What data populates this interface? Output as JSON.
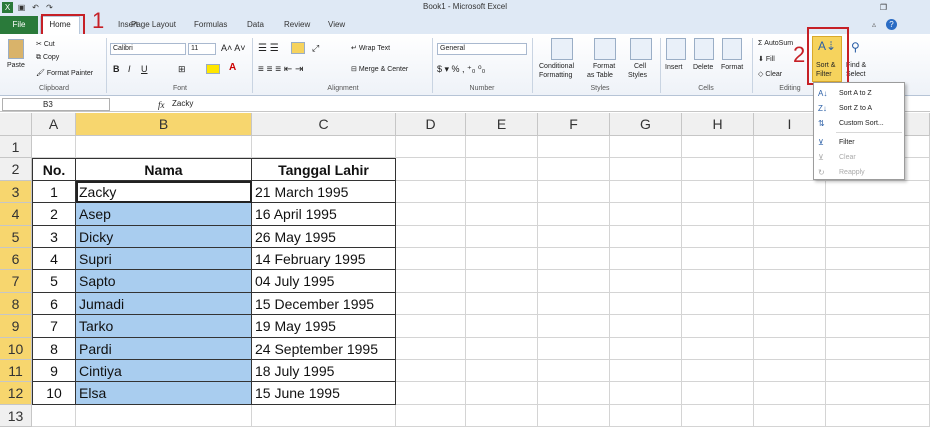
{
  "window": {
    "title": "Book1 - Microsoft Excel"
  },
  "ribbon_tabs": [
    "Home",
    "Insert",
    "Page Layout",
    "Formulas",
    "Data",
    "Review",
    "View"
  ],
  "file_tab": "File",
  "annotations": {
    "step1": "1",
    "step2": "2"
  },
  "clipboard": {
    "paste": "Paste",
    "cut": "Cut",
    "copy": "Copy",
    "format_painter": "Format Painter",
    "group": "Clipboard"
  },
  "font": {
    "name": "Calibri",
    "size": "11",
    "group": "Font"
  },
  "alignment": {
    "wrap": "Wrap Text",
    "merge": "Merge & Center",
    "group": "Alignment"
  },
  "number": {
    "format": "General",
    "group": "Number"
  },
  "styles": {
    "conditional": "Conditional",
    "conditional2": "Formatting",
    "format_as": "Format",
    "format_as2": "as Table",
    "cell_styles": "Cell",
    "cell_styles2": "Styles",
    "group": "Styles"
  },
  "cells": {
    "insert": "Insert",
    "delete": "Delete",
    "format": "Format",
    "group": "Cells"
  },
  "editing": {
    "autosum": "AutoSum",
    "fill": "Fill",
    "clear": "Clear",
    "sort_filter": "Sort &",
    "sort_filter2": "Filter",
    "find_select": "Find &",
    "find_select2": "Select",
    "group": "Editing"
  },
  "formula_bar": {
    "cell_ref": "B3",
    "fx": "fx",
    "value": "Zacky"
  },
  "columns": [
    "A",
    "B",
    "C",
    "D",
    "E",
    "F",
    "G",
    "H",
    "I"
  ],
  "rows": [
    "1",
    "2",
    "3",
    "4",
    "5",
    "6",
    "7",
    "8",
    "9",
    "10",
    "11",
    "12",
    "13"
  ],
  "table": {
    "headers": [
      "No.",
      "Nama",
      "Tanggal Lahir"
    ],
    "rows": [
      [
        "1",
        "Zacky",
        "21 March 1995"
      ],
      [
        "2",
        "Asep",
        "16 April 1995"
      ],
      [
        "3",
        "Dicky",
        "26 May 1995"
      ],
      [
        "4",
        "Supri",
        "14 February 1995"
      ],
      [
        "5",
        "Sapto",
        "04 July 1995"
      ],
      [
        "6",
        "Jumadi",
        "15 December 1995"
      ],
      [
        "7",
        "Tarko",
        "19 May 1995"
      ],
      [
        "8",
        "Pardi",
        "24 September 1995"
      ],
      [
        "9",
        "Cintiya",
        "18 July 1995"
      ],
      [
        "10",
        "Elsa",
        "15 June 1995"
      ]
    ]
  },
  "sort_menu": {
    "items": [
      {
        "label": "Sort A to Z",
        "enabled": true,
        "icon": "sort-az-icon"
      },
      {
        "label": "Sort Z to A",
        "enabled": true,
        "icon": "sort-za-icon"
      },
      {
        "label": "Custom Sort...",
        "enabled": true,
        "icon": "custom-sort-icon"
      },
      {
        "label": "Filter",
        "enabled": true,
        "icon": "filter-icon"
      },
      {
        "label": "Clear",
        "enabled": false,
        "icon": "clear-filter-icon"
      },
      {
        "label": "Reapply",
        "enabled": false,
        "icon": "reapply-icon"
      }
    ]
  },
  "colors": {
    "selection": "#a9cdef",
    "header_selected": "#f7d66e",
    "file_tab": "#2a7a3a",
    "annotation": "#c62026"
  }
}
